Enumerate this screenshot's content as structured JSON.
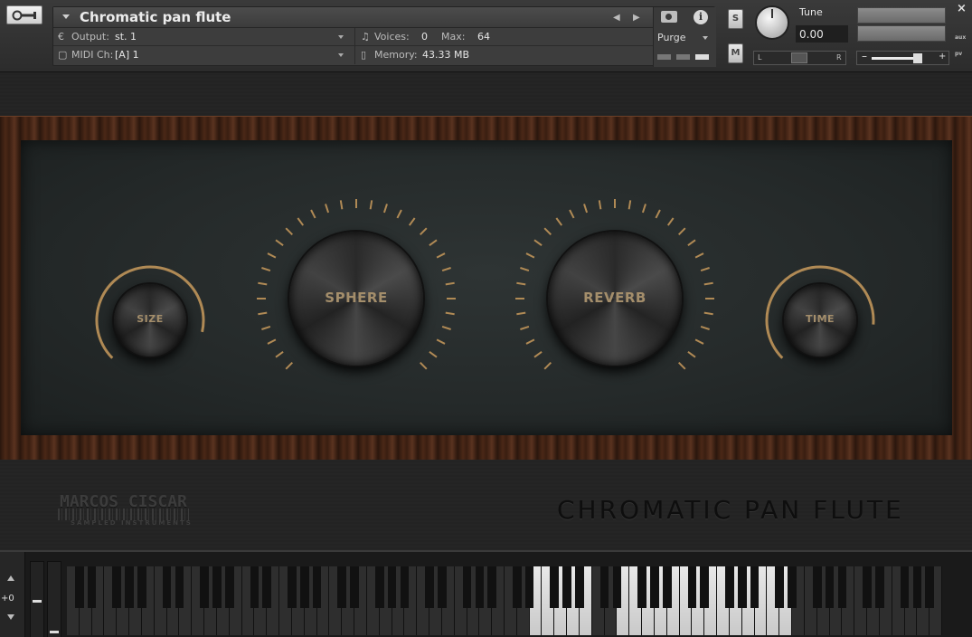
{
  "header": {
    "instrument_title": "Chromatic pan flute",
    "output_label": "Output:",
    "output_value": "st. 1",
    "voices_label": "Voices:",
    "voices_value": "0",
    "max_label": "Max:",
    "max_value": "64",
    "midi_label": "MIDI Ch:",
    "midi_value": "[A]  1",
    "memory_label": "Memory:",
    "memory_value": "43.33 MB",
    "purge_label": "Purge",
    "solo_label": "S",
    "mute_label": "M",
    "tune_label": "Tune",
    "tune_value": "0.00",
    "pan_left": "L",
    "pan_right": "R",
    "vol_minus": "–",
    "vol_plus": "+",
    "close_label": "×",
    "aux_label": "aux",
    "pv_label": "pv",
    "info_label": "i"
  },
  "controls": {
    "size": {
      "label": "SIZE",
      "value": 0.88
    },
    "sphere": {
      "label": "SPHERE"
    },
    "reverb": {
      "label": "REVERB"
    },
    "time": {
      "label": "TIME",
      "value": 0.85
    }
  },
  "branding": {
    "logo": "MARCOS CISCAR",
    "logo_sub": "SAMPLED INSTRUMENTS",
    "product": "CHROMATIC PAN FLUTE"
  },
  "keyboard": {
    "octave_value": "+0"
  },
  "colors": {
    "accent_gold": "#b08a55",
    "knob_label": "#a48e6b",
    "wood": "#4a2817"
  }
}
